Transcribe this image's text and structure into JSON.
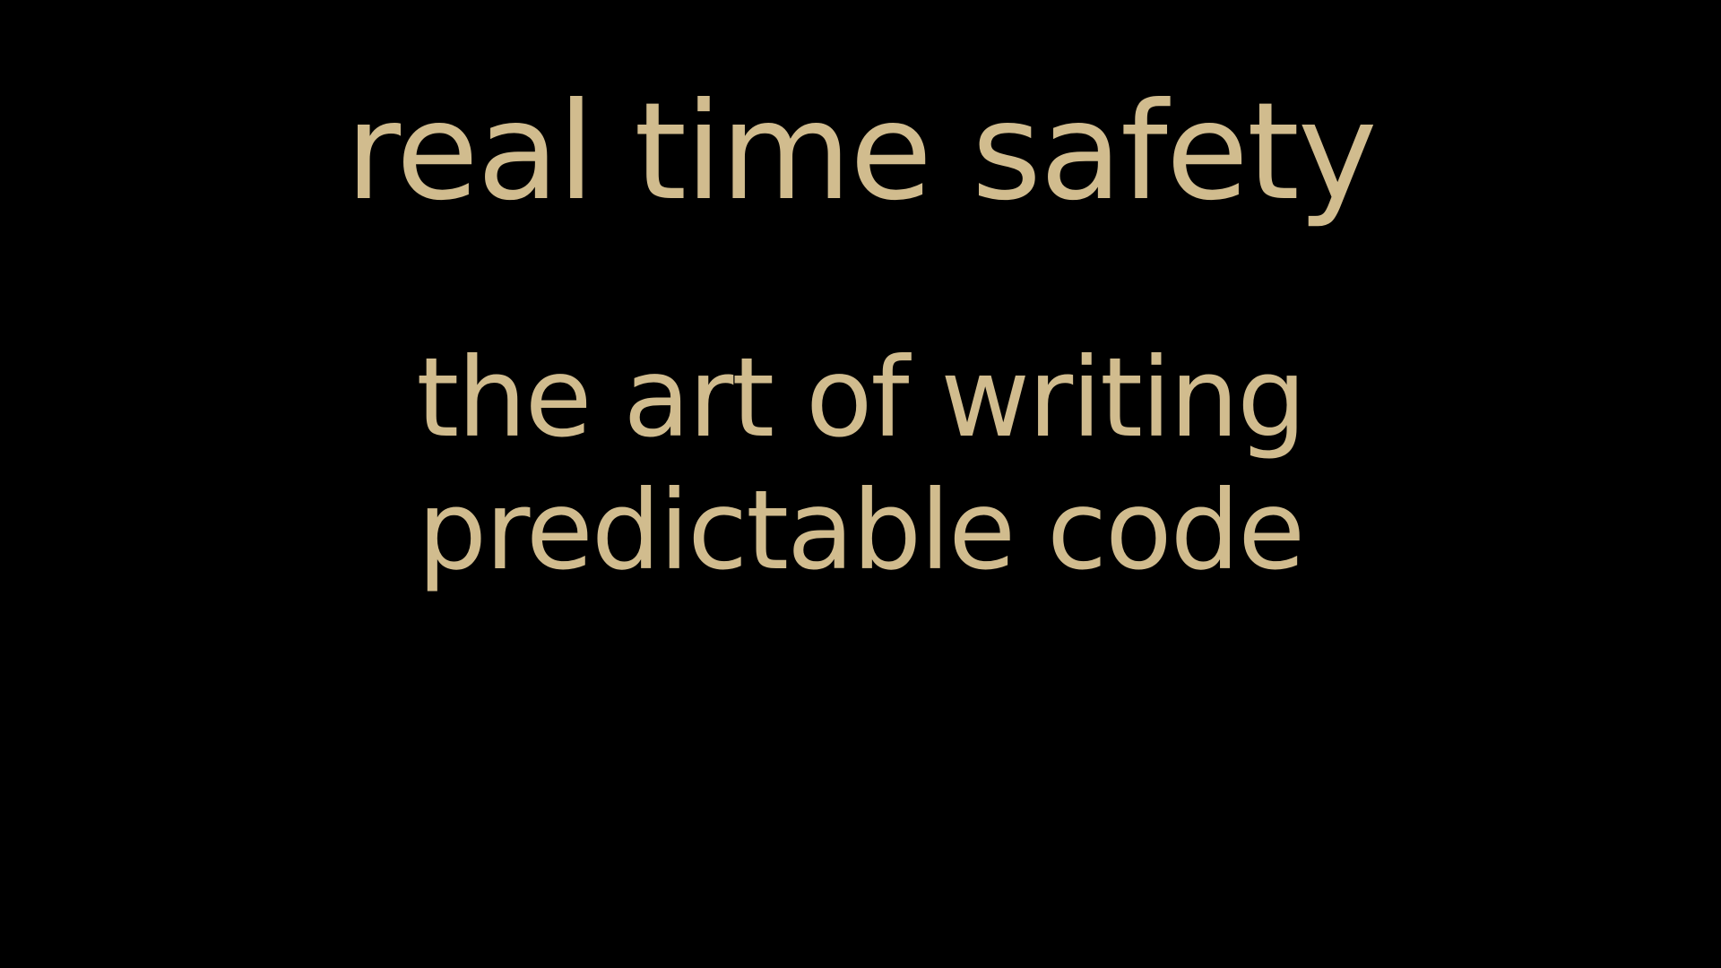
{
  "slide": {
    "title": "real time safety",
    "subtitle_lines": [
      "the art of writing",
      "predictable code"
    ]
  },
  "colors": {
    "background": "#000000",
    "text": "#d1bc8e"
  }
}
